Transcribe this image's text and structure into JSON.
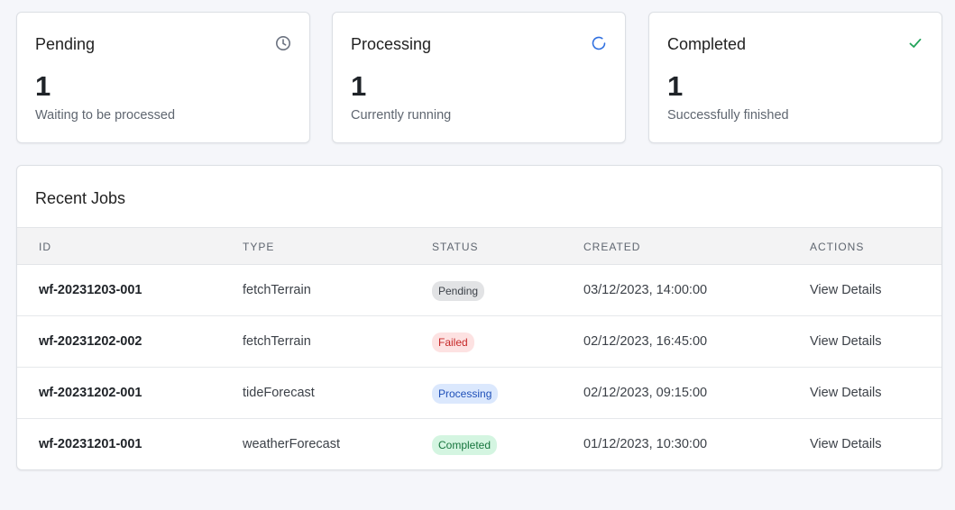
{
  "cards": [
    {
      "title": "Pending",
      "count": "1",
      "subtitle": "Waiting to be processed",
      "icon": "clock-icon",
      "icon_color": "#6b7280"
    },
    {
      "title": "Processing",
      "count": "1",
      "subtitle": "Currently running",
      "icon": "spinner-icon",
      "icon_color": "#2f6fe0"
    },
    {
      "title": "Completed",
      "count": "1",
      "subtitle": "Successfully finished",
      "icon": "check-icon",
      "icon_color": "#22a35a"
    }
  ],
  "jobs": {
    "title": "Recent Jobs",
    "columns": [
      "ID",
      "TYPE",
      "STATUS",
      "CREATED",
      "ACTIONS"
    ],
    "rows": [
      {
        "id": "wf-20231203-001",
        "type": "fetchTerrain",
        "status": "Pending",
        "status_key": "pending",
        "created": "03/12/2023, 14:00:00",
        "action": "View Details"
      },
      {
        "id": "wf-20231202-002",
        "type": "fetchTerrain",
        "status": "Failed",
        "status_key": "failed",
        "created": "02/12/2023, 16:45:00",
        "action": "View Details"
      },
      {
        "id": "wf-20231202-001",
        "type": "tideForecast",
        "status": "Processing",
        "status_key": "processing",
        "created": "02/12/2023, 09:15:00",
        "action": "View Details"
      },
      {
        "id": "wf-20231201-001",
        "type": "weatherForecast",
        "status": "Completed",
        "status_key": "completed",
        "created": "01/12/2023, 10:30:00",
        "action": "View Details"
      }
    ]
  }
}
